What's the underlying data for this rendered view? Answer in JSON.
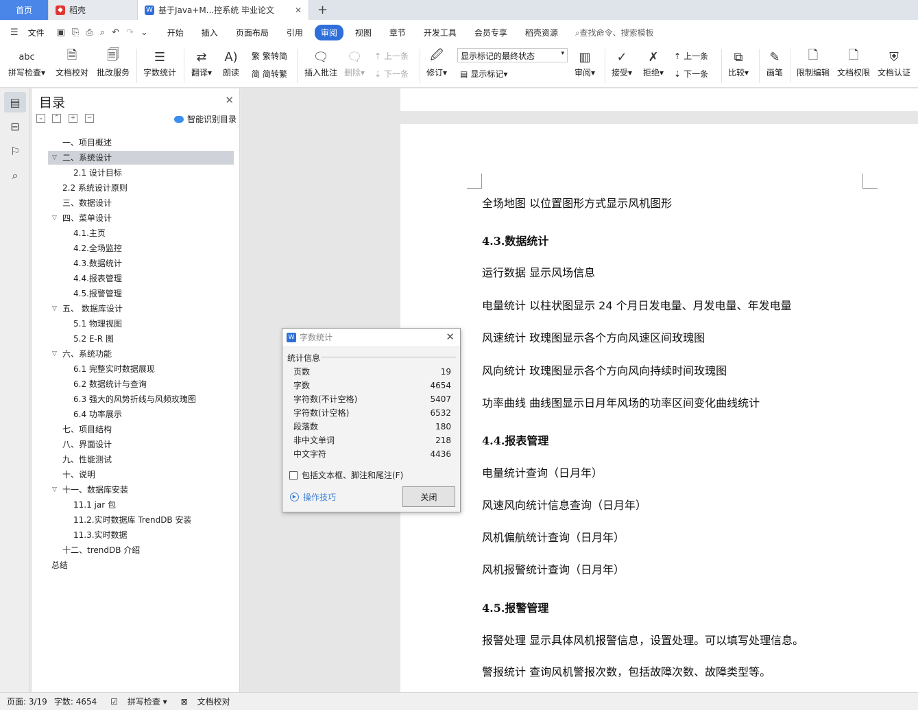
{
  "tabs": {
    "home": "首页",
    "daoke": "稻壳",
    "doc": "基于Java+M...控系统 毕业论文",
    "add": "+"
  },
  "menubar": {
    "file": "文件",
    "items": [
      "开始",
      "插入",
      "页面布局",
      "引用",
      "审阅",
      "视图",
      "章节",
      "开发工具",
      "会员专享",
      "稻壳资源"
    ],
    "active": "审阅",
    "search": "查找命令、搜索模板"
  },
  "ribbon": {
    "spell": "拼写检查",
    "proof": "文档校对",
    "correct": "批改服务",
    "wordcount": "字数统计",
    "translate": "翻译",
    "read": "朗读",
    "trad": "繁转简",
    "simp": "简转繁",
    "insert_comment": "插入批注",
    "delete": "删除",
    "prev": "上一条",
    "next": "下一条",
    "revise": "修订",
    "markup_combo": "显示标记的最终状态",
    "show_markup": "显示标记",
    "review": "审阅",
    "accept": "接受",
    "reject": "拒绝",
    "prev2": "上一条",
    "next2": "下一条",
    "compare": "比较",
    "pen": "画笔",
    "restrict": "限制编辑",
    "perm": "文档权限",
    "cert": "文档认证",
    "abc": "abc"
  },
  "toc": {
    "title": "目录",
    "smart": "智能识别目录",
    "items": [
      "一、项目概述",
      "二、系统设计",
      "2.1  设计目标",
      "2.2  系统设计原则",
      "三、数据设计",
      "四、菜单设计",
      "4.1.主页",
      "4.2.全场监控",
      "4.3.数据统计",
      "4.4.报表管理",
      "4.5.报警管理",
      "五、  数据库设计",
      "5.1  物理视图",
      "5.2 E-R  图",
      "六、系统功能",
      "6.1  完整实时数据展现",
      "6.2  数据统计与查询",
      "6.3  强大的风势折线与风频玫瑰图",
      "6.4  功率展示",
      "七、项目结构",
      "八、界面设计",
      "九、性能测试",
      "十、说明",
      "十一、数据库安装",
      "11.1 jar  包",
      "11.2.实时数据库  TrendDB  安装",
      "11.3.实时数据",
      "十二、trendDB  介绍",
      "总结"
    ]
  },
  "document": {
    "lines": [
      "全场地图  以位置图形方式显示风机图形",
      "4.3.数据统计",
      "运行数据  显示风场信息",
      "电量统计  以柱状图显示  24  个月日发电量、月发电量、年发电量",
      "风速统计  玫瑰图显示各个方向风速区间玫瑰图",
      "风向统计  玫瑰图显示各个方向风向持续时间玫瑰图",
      "功率曲线  曲线图显示日月年风场的功率区间变化曲线统计",
      "4.4.报表管理",
      "电量统计查询（日月年）",
      "风速风向统计信息查询（日月年）",
      "风机偏航统计查询（日月年）",
      "风机报警统计查询（日月年）",
      "4.5.报警管理",
      "报警处理  显示具体风机报警信息，设置处理。可以填写处理信息。",
      "警报统计  查询风机警报次数，包括故障次数、故障类型等。"
    ]
  },
  "dialog": {
    "title": "字数统计",
    "section": "统计信息",
    "rows": [
      {
        "label": "页数",
        "value": "19"
      },
      {
        "label": "字数",
        "value": "4654"
      },
      {
        "label": "字符数(不计空格)",
        "value": "5407"
      },
      {
        "label": "字符数(计空格)",
        "value": "6532"
      },
      {
        "label": "段落数",
        "value": "180"
      },
      {
        "label": "非中文单词",
        "value": "218"
      },
      {
        "label": "中文字符",
        "value": "4436"
      }
    ],
    "checkbox": "包括文本框、脚注和尾注(F)",
    "tips": "操作技巧",
    "close": "关闭"
  },
  "status": {
    "page": "页面: 3/19",
    "words": "字数: 4654",
    "spell": "拼写检查",
    "proof": "文档校对"
  },
  "colors": {
    "accent": "#2e6fd9",
    "home_tab": "#4a86e8",
    "link": "#3a7fd5"
  }
}
